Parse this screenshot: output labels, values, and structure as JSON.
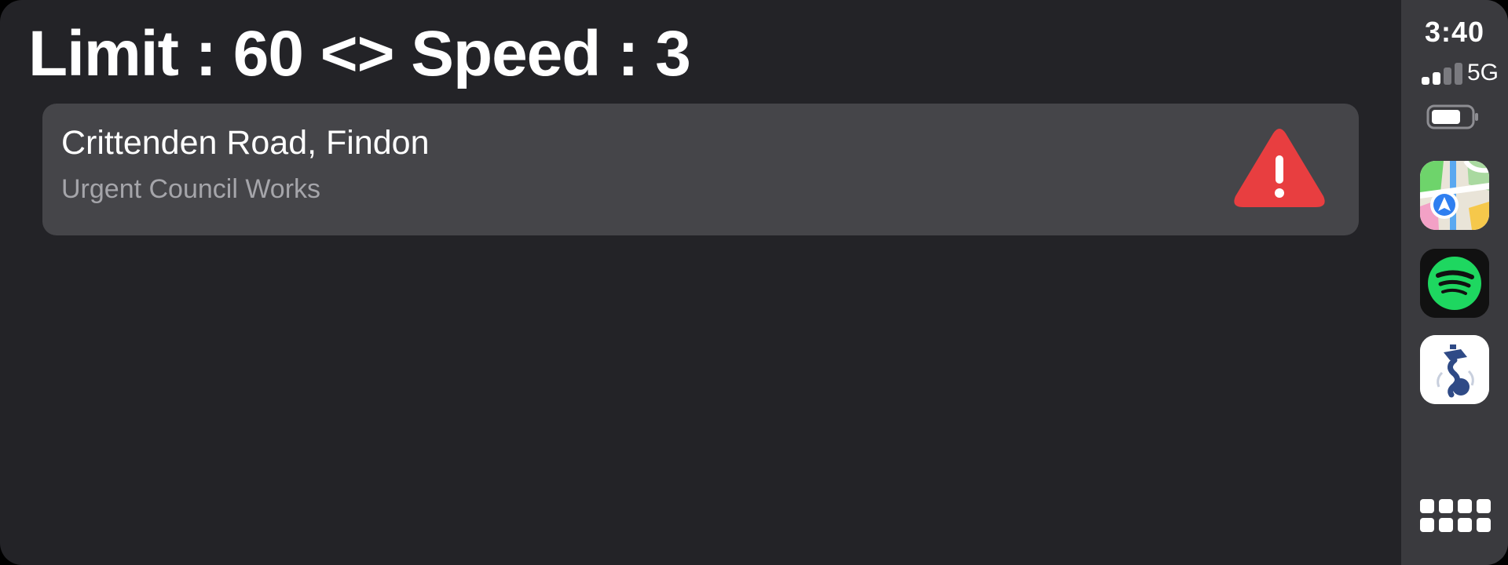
{
  "header": {
    "title": "Limit : 60 <> Speed : 3"
  },
  "alert": {
    "road": "Crittenden Road, Findon",
    "type": "Urgent Council Works",
    "icon": "warning-triangle-icon",
    "icon_color": "#e83e40"
  },
  "status": {
    "time": "3:40",
    "network": "5G",
    "signal_bars_active": 2,
    "signal_bars_total": 4,
    "battery_level": 0.75
  },
  "dock": {
    "apps": [
      {
        "name": "Maps",
        "icon": "maps-app-icon"
      },
      {
        "name": "Spotify",
        "icon": "spotify-app-icon"
      },
      {
        "name": "Police",
        "icon": "police-app-icon"
      }
    ],
    "app_grid_icon": "app-grid-icon"
  },
  "colors": {
    "background": "#232327",
    "card": "#454549",
    "sidebar": "#3a3a3e",
    "secondary_text": "#a5a5aa",
    "spotify_green": "#1ed760"
  }
}
